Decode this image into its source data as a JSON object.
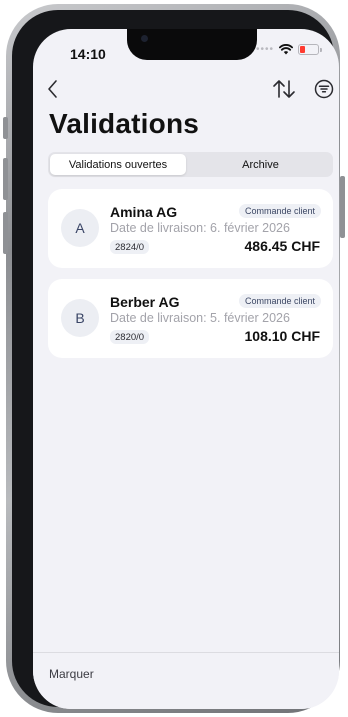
{
  "status_bar": {
    "time": "14:10",
    "battery_color": "#ff3b30"
  },
  "header": {
    "back_icon": "chevron-left-icon",
    "sort_icon": "sort-arrows-icon",
    "filter_icon": "filter-circle-icon",
    "title": "Validations"
  },
  "segmented_control": {
    "tabs": [
      {
        "label": "Validations ouvertes",
        "selected": true
      },
      {
        "label": "Archive",
        "selected": false
      }
    ]
  },
  "validations": [
    {
      "avatar_letter": "A",
      "name": "Amina AG",
      "type_badge": "Commande client",
      "delivery_date": "Date de livraison: 6. février 2026",
      "order_number": "2824/0",
      "amount": "486.45 CHF"
    },
    {
      "avatar_letter": "B",
      "name": "Berber AG",
      "type_badge": "Commande client",
      "delivery_date": "Date de livraison: 5. février 2026",
      "order_number": "2820/0",
      "amount": "108.10 CHF"
    }
  ],
  "bottom_bar": {
    "mark_label": "Marquer"
  }
}
